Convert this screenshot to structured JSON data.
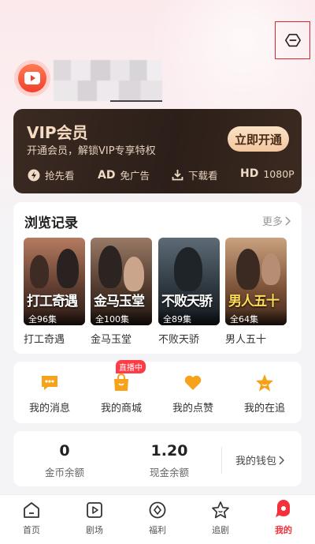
{
  "user": {
    "avatar_icon": "play-avatar-icon"
  },
  "header": {
    "settings_icon": "hexagon-minus-icon"
  },
  "vip": {
    "title": "VIP会员",
    "subtitle": "开通会员，解锁VIP专享特权",
    "button": "立即开通",
    "perks": [
      {
        "icon": "lightning-icon",
        "label": "抢先看"
      },
      {
        "tag": "AD",
        "label": "免广告"
      },
      {
        "icon": "download-icon",
        "label": "下载看"
      },
      {
        "tag": "HD",
        "label": "1080P"
      }
    ]
  },
  "history": {
    "title": "浏览记录",
    "more": "更多",
    "items": [
      {
        "name": "打工奇遇",
        "poster_title": "打工奇遇",
        "episodes": "全96集",
        "color": "#7a4b3d"
      },
      {
        "name": "金马玉堂",
        "poster_title": "金马玉堂",
        "episodes": "全100集",
        "color": "#5a3b2d"
      },
      {
        "name": "不败天骄",
        "poster_title": "不败天骄",
        "episodes": "全89集",
        "color": "#2e3a45"
      },
      {
        "name": "男人五十",
        "poster_title": "男人五十",
        "episodes": "全64集",
        "color": "#6a4a35"
      }
    ]
  },
  "actions": {
    "live_badge": "直播中",
    "items": [
      {
        "label": "我的消息",
        "icon": "message-icon"
      },
      {
        "label": "我的商城",
        "icon": "shopping-bag-icon"
      },
      {
        "label": "我的点赞",
        "icon": "heart-icon"
      },
      {
        "label": "我的在追",
        "icon": "star-icon"
      }
    ]
  },
  "wallet": {
    "coins_value": "0",
    "coins_label": "金币余额",
    "cash_value": "1.20",
    "cash_label": "现金余额",
    "link": "我的钱包"
  },
  "tabbar": {
    "items": [
      {
        "label": "首页",
        "icon": "home-icon"
      },
      {
        "label": "剧场",
        "icon": "play-square-icon"
      },
      {
        "label": "福利",
        "icon": "gift-diamond-icon"
      },
      {
        "label": "追剧",
        "icon": "star-outline-icon"
      },
      {
        "label": "我的",
        "icon": "profile-icon"
      }
    ],
    "active_color": "#f2313b"
  }
}
